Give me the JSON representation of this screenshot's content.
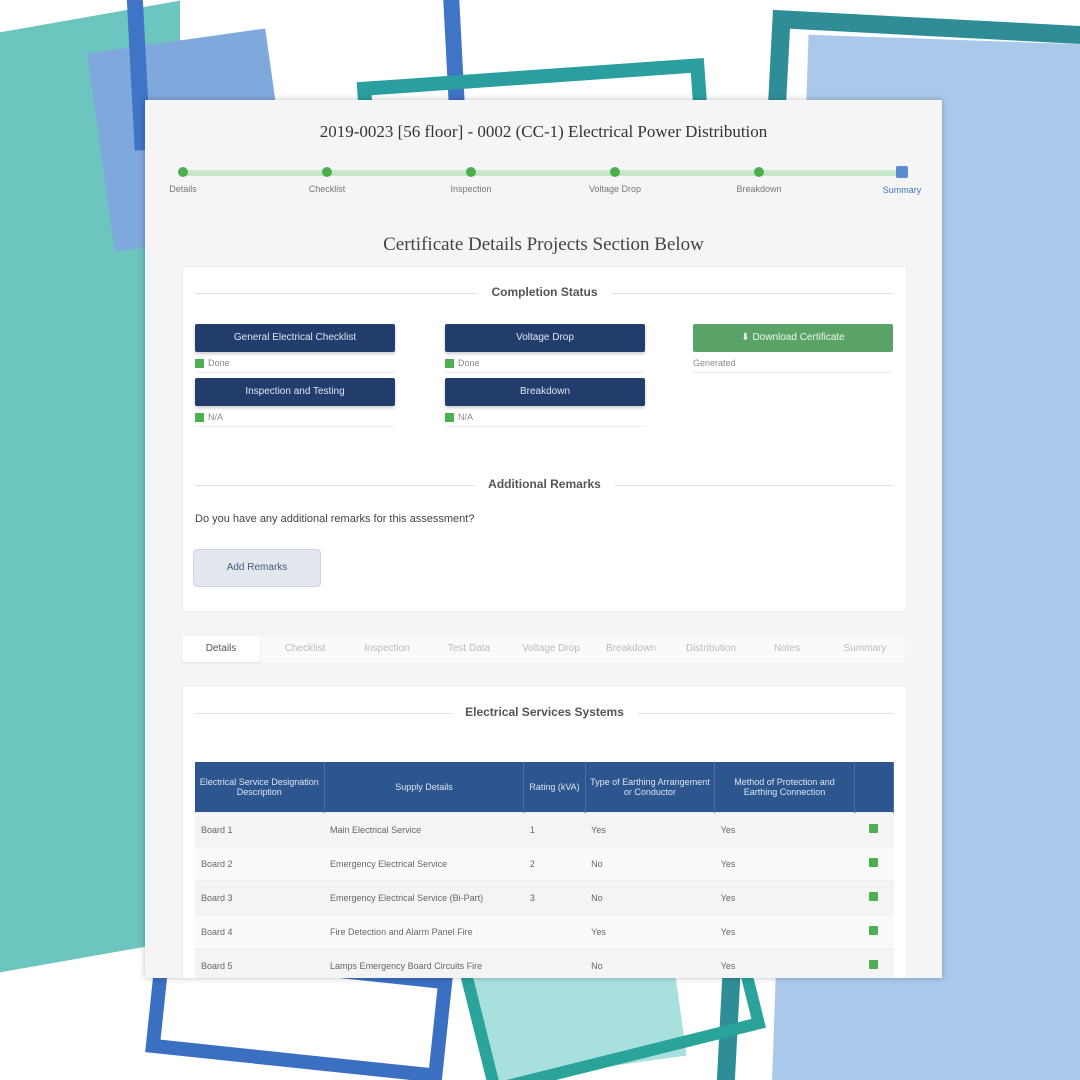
{
  "document": {
    "title": "2019-0023 [56 floor] - 0002 (CC-1) Electrical Power Distribution"
  },
  "stepper": {
    "steps": [
      {
        "label": "Details",
        "state": "done"
      },
      {
        "label": "Checklist",
        "state": "done"
      },
      {
        "label": "Inspection",
        "state": "done"
      },
      {
        "label": "Voltage Drop",
        "state": "done"
      },
      {
        "label": "Breakdown",
        "state": "done"
      },
      {
        "label": "Summary",
        "state": "active"
      }
    ]
  },
  "section_heading": "Certificate Details Projects Section Below",
  "completion": {
    "title": "Completion Status",
    "buttons": [
      {
        "label": "General Electrical Checklist",
        "status": "Done"
      },
      {
        "label": "Voltage Drop",
        "status": "Done"
      },
      {
        "label": "Inspection and Testing",
        "status": "N/A"
      },
      {
        "label": "Breakdown",
        "status": "N/A"
      }
    ],
    "download_button": {
      "label": "Download Certificate",
      "status": "Generated"
    }
  },
  "remarks": {
    "title": "Additional Remarks",
    "question": "Do you have any additional remarks for this assessment?",
    "button_label": "Add Remarks"
  },
  "tabs": [
    {
      "label": "Details",
      "active": true
    },
    {
      "label": "Checklist",
      "active": false
    },
    {
      "label": "Inspection",
      "active": false
    },
    {
      "label": "Test Data",
      "active": false
    },
    {
      "label": "Voltage Drop",
      "active": false
    },
    {
      "label": "Breakdown",
      "active": false
    },
    {
      "label": "Distribution",
      "active": false
    },
    {
      "label": "Notes",
      "active": false
    },
    {
      "label": "Summary",
      "active": false
    }
  ],
  "systems": {
    "title": "Electrical Services Systems",
    "columns": [
      "Electrical Service Designation Description",
      "Supply Details",
      "Rating (kVA)",
      "Type of Earthing Arrangement or Conductor",
      "Method of Protection and Earthing Connection"
    ],
    "rows": [
      {
        "designation": "Board 1",
        "supply": "Main Electrical Service",
        "rating": "1",
        "earthing": "Yes",
        "protection": "Yes"
      },
      {
        "designation": "Board 2",
        "supply": "Emergency Electrical Service",
        "rating": "2",
        "earthing": "No",
        "protection": "Yes"
      },
      {
        "designation": "Board 3",
        "supply": "Emergency Electrical Service (Bi-Part)",
        "rating": "3",
        "earthing": "No",
        "protection": "Yes"
      },
      {
        "designation": "Board 4",
        "supply": "Fire Detection and Alarm Panel Fire",
        "rating": "",
        "earthing": "Yes",
        "protection": "Yes"
      },
      {
        "designation": "Board 5",
        "supply": "Lamps Emergency Board Circuits Fire",
        "rating": "",
        "earthing": "No",
        "protection": "Yes"
      }
    ]
  },
  "colors": {
    "navy": "#223d6b",
    "table_header": "#2d568f",
    "success": "#4caf50",
    "accent": "#3f74c6"
  }
}
